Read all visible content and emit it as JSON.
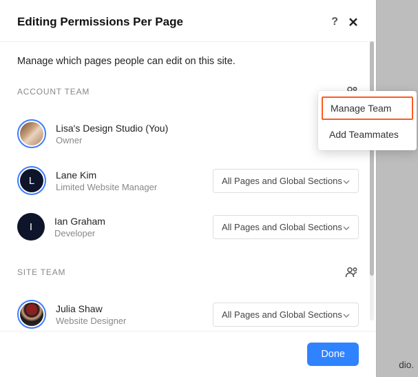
{
  "header": {
    "title": "Editing Permissions Per Page"
  },
  "subtitle": "Manage which pages people can edit on this site.",
  "sections": {
    "account": {
      "label": "ACCOUNT TEAM"
    },
    "site": {
      "label": "SITE TEAM"
    }
  },
  "members": {
    "lisa": {
      "name": "Lisa's Design Studio (You)",
      "role": "Owner"
    },
    "lane": {
      "name": "Lane Kim",
      "role": "Limited Website Manager",
      "initial": "L",
      "permission": "All Pages and Global Sections"
    },
    "ian": {
      "name": "Ian Graham",
      "role": "Developer",
      "initial": "I",
      "permission": "All Pages and Global Sections"
    },
    "julia": {
      "name": "Julia Shaw",
      "role": "Website Designer",
      "permission": "All Pages and Global Sections"
    }
  },
  "dropdown": {
    "manage": "Manage Team",
    "add": "Add Teammates"
  },
  "footer": {
    "done": "Done"
  },
  "bg_text": "dio."
}
